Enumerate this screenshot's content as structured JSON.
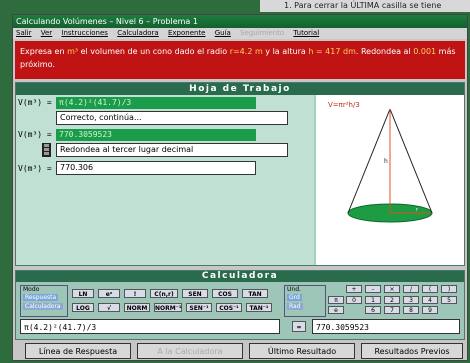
{
  "background_corner": "1. Para cerrar la ÚLTIMA casilla se tiene",
  "window_title": "Calculando Volúmenes  –  Nivel 6  –  Problema 1",
  "menu": [
    "Salir",
    "Ver",
    "Instrucciones",
    "Calculadora",
    "Exponente",
    "Guía",
    "Seguimiento",
    "Tutorial"
  ],
  "problem": {
    "p1": "Expresa en ",
    "unit": "m³",
    "p2": " el volumen de un cono dado el radio ",
    "radius": "r=4.2 m",
    "p3": " y la altura ",
    "height": "h = 417 dm",
    "p4": ". Redondea al ",
    "precision": "0.001",
    "p5": " más próximo."
  },
  "worksheet": {
    "title": "Hoja de Trabajo",
    "label": "V(m³) =",
    "expr": "π(4.2)²(41.7)/3",
    "feedback1": "Correcto, continúa...",
    "value": "770.3059523",
    "feedback2": "Redondea al tercer lugar decimal",
    "answer": "770.306"
  },
  "figure": {
    "formula": "V=πr²h/3",
    "h_label": "h",
    "r_label": "r"
  },
  "calculator": {
    "title": "Calculadora",
    "modo_label": "Modo",
    "modo_options": [
      "Respuesta",
      "Calculadora"
    ],
    "row1": [
      "LN",
      "eˣ",
      "!",
      "C(n,r)",
      "SEN",
      "COS",
      "TAN"
    ],
    "row2": [
      "LOG",
      "√",
      "NORM",
      "NORM⁻¹",
      "SEN⁻¹",
      "COS⁻¹",
      "TAN⁻¹"
    ],
    "und_label": "Und.",
    "und_options": [
      "Grd",
      "Rad"
    ],
    "ops": [
      "+",
      "–",
      "×",
      "/",
      "(",
      ")"
    ],
    "nums": [
      "π",
      "0",
      "1",
      "2",
      "3",
      "4",
      "5",
      "6",
      "7",
      "8",
      "9",
      "e"
    ],
    "input": "π(4.2)²(41.7)/3",
    "equals": "=",
    "result": "770.3059523"
  },
  "buttons": [
    "Línea de Respuesta",
    "A la Calculadora",
    "Último Resultado",
    "Resultados Previos"
  ]
}
